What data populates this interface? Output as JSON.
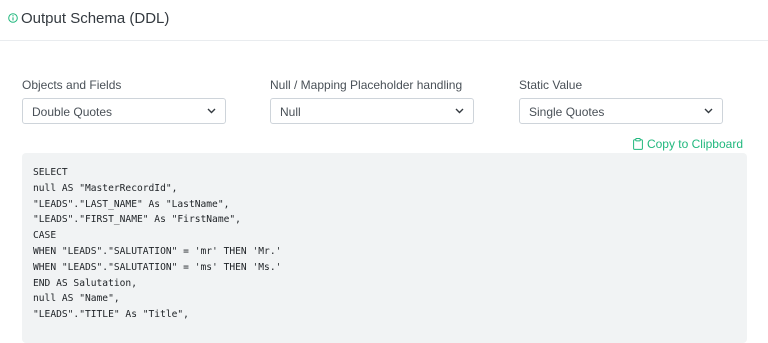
{
  "header": {
    "title": "Output Schema (DDL)",
    "icon": "info-circle-icon",
    "icon_color": "#21b87e"
  },
  "fields": [
    {
      "label": "Objects and Fields",
      "value": "Double Quotes"
    },
    {
      "label": "Null / Mapping Placeholder handling",
      "value": "Null"
    },
    {
      "label": "Static Value",
      "value": "Single Quotes"
    }
  ],
  "copy_label": "Copy to Clipboard",
  "accent_color": "#21b87e",
  "code_lines": [
    "SELECT",
    "null AS \"MasterRecordId\",",
    "\"LEADS\".\"LAST_NAME\" As \"LastName\",",
    "\"LEADS\".\"FIRST_NAME\" As \"FirstName\",",
    "CASE",
    "WHEN \"LEADS\".\"SALUTATION\" = 'mr' THEN 'Mr.'",
    "WHEN \"LEADS\".\"SALUTATION\" = 'ms' THEN 'Ms.'",
    "END AS Salutation,",
    "null AS \"Name\",",
    "\"LEADS\".\"TITLE\" As \"Title\","
  ]
}
